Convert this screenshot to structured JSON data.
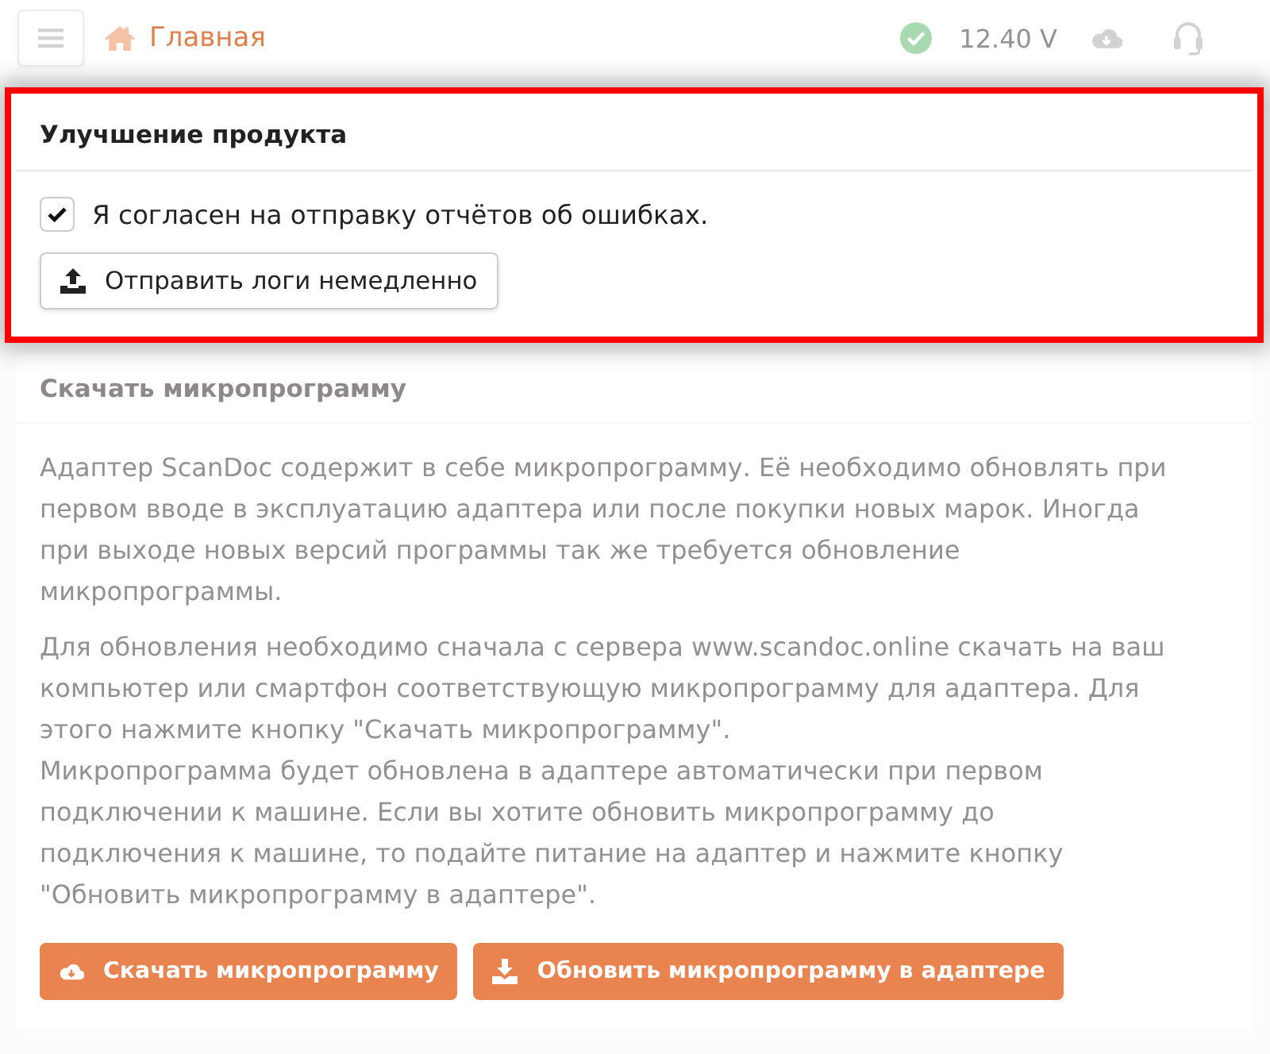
{
  "top_bar": {
    "highlighted": false,
    "title": "Главная",
    "voltage": "12.40 V"
  },
  "product_improvement": {
    "highlighted": true,
    "title": "Улучшение продукта",
    "consent": {
      "label": "Я согласен на отправку отчётов об ошибках.",
      "checked": true
    },
    "button": "Отправить логи немедленно"
  },
  "firmware": {
    "highlighted": false,
    "title": "Скачать микропрограмму",
    "paragraphs": [
      "Адаптер ScanDoc содержит в себе микропрограмму. Её необходимо обновлять при первом вводе в эксплуатацию адаптера или после покупки новых марок. Иногда при выходе новых версий программы так же требуется обновление микропрограммы.",
      "Для обновления необходимо сначала с сервера www.scandoc.online скачать на ваш компьютер или смартфон соответствующую микропрограмму для адаптера. Для этого нажмите кнопку \"Скачать микропрограмму\".\nМикропрограмма будет обновлена в адаптере автоматически при первом подключении к машине. Если вы хотите обновить микропрограмму до подключения к машине, то подайте питание на адаптер и нажмите кнопку \"Обновить микропрограмму в адаптере\"."
    ],
    "buttons": [
      {
        "kind": "cloud",
        "label": "Скачать микропрограмму"
      },
      {
        "kind": "tray",
        "label": "Обновить микропрограмму в адаптере"
      }
    ]
  }
}
